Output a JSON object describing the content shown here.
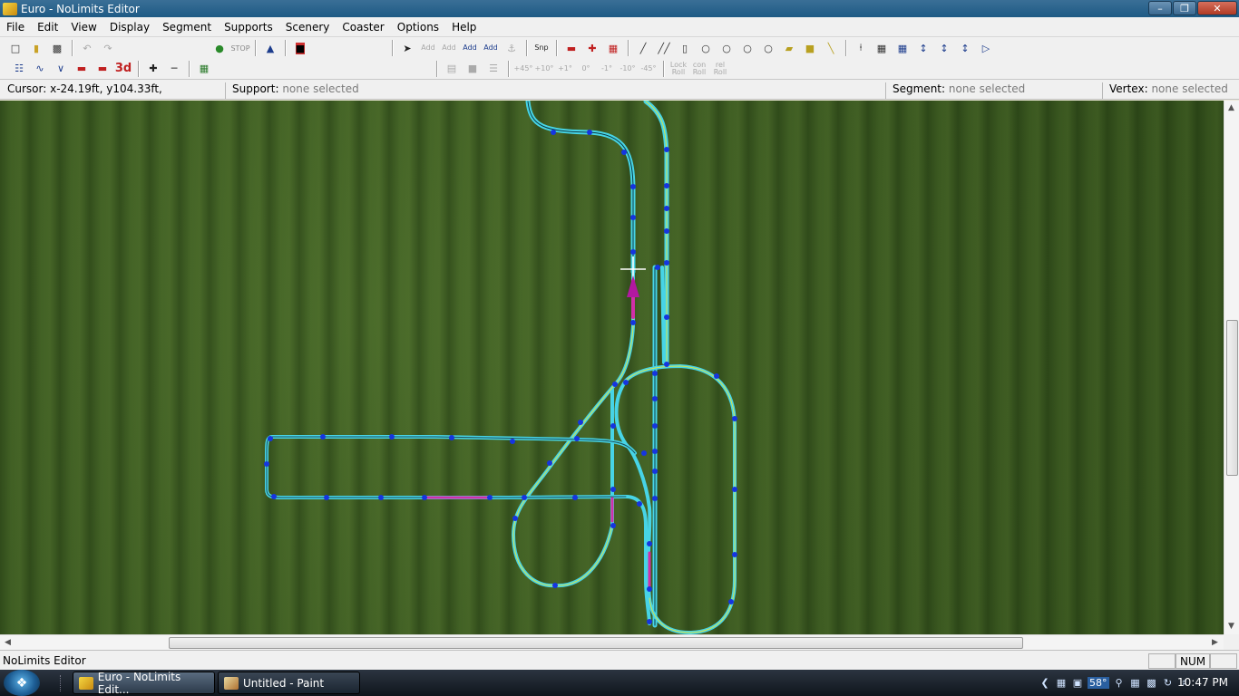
{
  "window": {
    "title": "Euro - NoLimits Editor",
    "controls": [
      "minimize-icon",
      "maximize-icon",
      "close-icon"
    ]
  },
  "menubar": {
    "items": [
      "File",
      "Edit",
      "View",
      "Display",
      "Segment",
      "Supports",
      "Scenery",
      "Coaster",
      "Options",
      "Help"
    ]
  },
  "toolbar": {
    "row1_labels": {
      "add_straight": "Add",
      "add_curve": "Add",
      "add_vertex": "Add",
      "add_support": "Add",
      "snap": "Snp"
    },
    "row2_labels": {
      "plus45": "+45°",
      "plus10": "+10°",
      "plus1": "+1°",
      "zero": "0°",
      "minus1": "-1°",
      "minus10": "-10°",
      "minus45": "-45°",
      "lock_roll": "Lock Roll",
      "con_roll": "con Roll",
      "rel_roll": "rel Roll",
      "three_d": "3d"
    }
  },
  "infobar": {
    "cursor_label": "Cursor:",
    "cursor_value": "x-24.19ft, y104.33ft,",
    "support_label": "Support:",
    "support_value": "none selected",
    "segment_label": "Segment:",
    "segment_value": "none selected",
    "vertex_label": "Vertex:",
    "vertex_value": "none selected"
  },
  "statusbar": {
    "message": "NoLimits Editor",
    "num": "NUM"
  },
  "taskbar": {
    "start_icon": "windows-orb-icon",
    "tasks": [
      {
        "label": "Euro - NoLimits Edit...",
        "icon": "nolimits-icon"
      },
      {
        "label": "Untitled - Paint",
        "icon": "paint-icon"
      }
    ],
    "temperature": "58°",
    "clock": "10:47 PM"
  },
  "colors": {
    "track_rail": "#47d4e6",
    "track_alt": "#d8e64a",
    "vertex": "#1535e0",
    "selected": "#d22fa8",
    "grass": "#3d5a22"
  }
}
